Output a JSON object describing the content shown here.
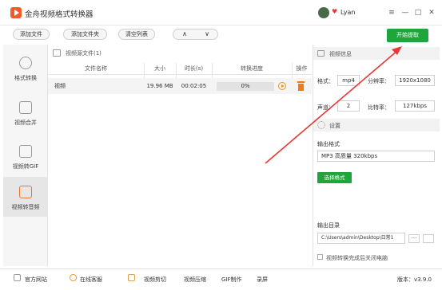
{
  "titlebar": {
    "title": "金舟视频格式转换器",
    "user_name": "Lyan"
  },
  "toolbar": {
    "add_file": "添加文件",
    "add_folder": "添加文件夹",
    "clear_list": "清空列表",
    "move_up": "∧",
    "move_down": "∨",
    "start": "开始提取"
  },
  "sidebar": {
    "items": [
      {
        "label": "格式转换"
      },
      {
        "label": "视频合并"
      },
      {
        "label": "视频转GIF"
      },
      {
        "label": "视频转音频"
      }
    ],
    "active_index": 3
  },
  "filelist": {
    "title": "视频源文件(1)",
    "columns": [
      "文件名称",
      "大小",
      "时长(s)",
      "转换进度",
      "操作"
    ],
    "rows": [
      {
        "name": "视频",
        "size": "19.96 MB",
        "duration": "00:02:05",
        "progress": "0%"
      }
    ]
  },
  "video_info": {
    "title": "视频信息",
    "format_label": "格式：",
    "format_value": "mp4",
    "resolution_label": "分辨率：",
    "resolution_value": "1920x1080",
    "channel_label": "声道：",
    "channel_value": "2",
    "bitrate_label": "比特率：",
    "bitrate_value": "127kbps"
  },
  "settings": {
    "title": "设置",
    "output_format_label": "输出格式",
    "output_format_value": "MP3 高质量 320kbps",
    "select_format_button": "选择格式",
    "output_dir_label": "输出目录",
    "output_dir_value": "C:\\Users\\admin\\Desktop\\日常1",
    "browse_dots": "···",
    "shutdown_label": "视频转换完成后关闭电脑"
  },
  "footer": {
    "official_site": "官方网站",
    "online_service": "在线客服",
    "video_cut": "视频剪切",
    "video_compress": "视频压缩",
    "gif_make": "GIF制作",
    "screen_record": "录屏",
    "version": "版本：v3.9.0"
  },
  "colors": {
    "accent_green": "#1ea53c",
    "accent_orange": "#f2931e",
    "arrow_red": "#e53935"
  }
}
